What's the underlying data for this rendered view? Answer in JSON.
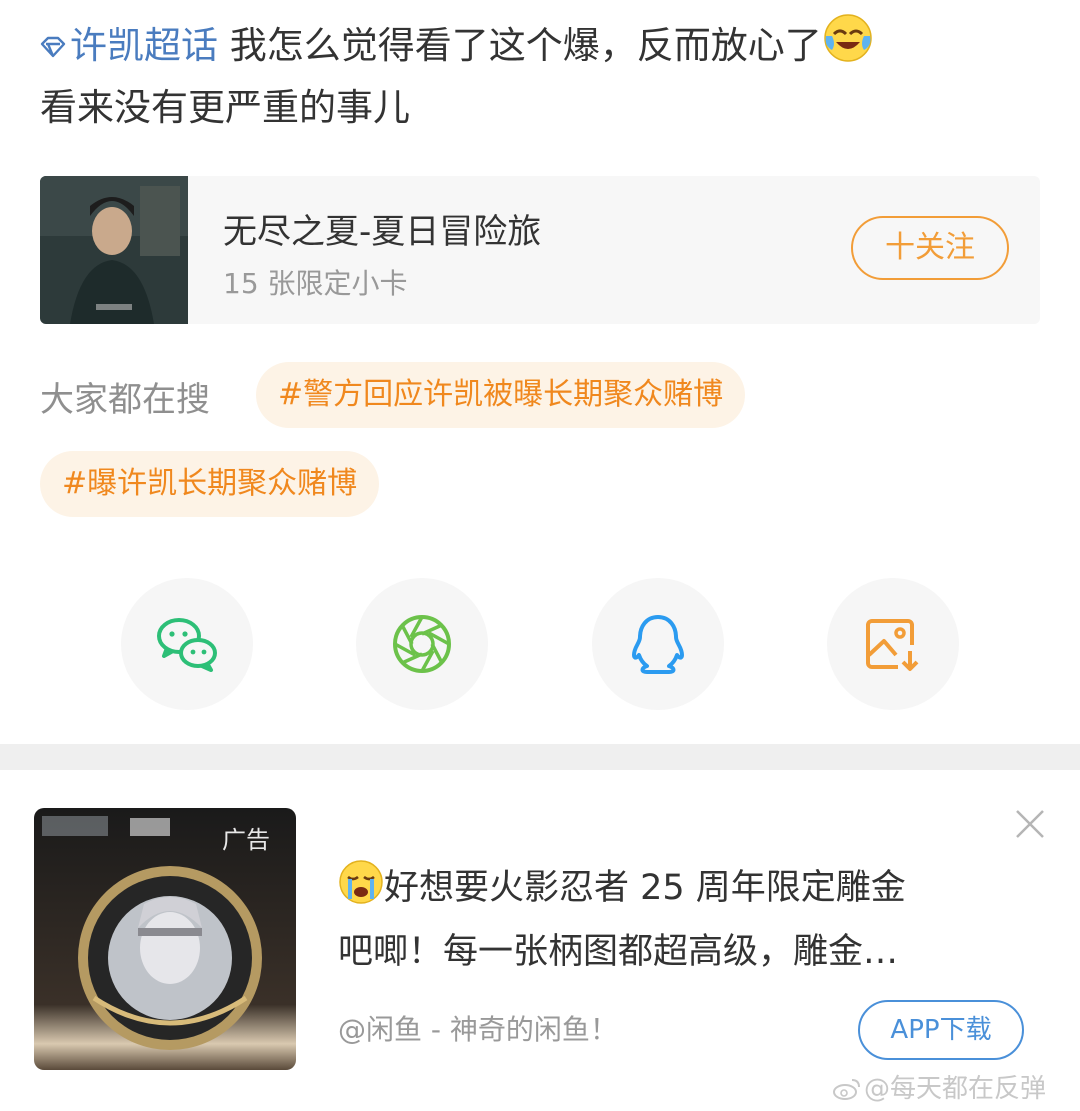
{
  "post": {
    "topic_link": "许凯超话",
    "text_line1": "我怎么觉得看了这个爆，反而放心了",
    "text_line2": "看来没有更严重的事儿"
  },
  "card": {
    "title": "无尽之夏-夏日冒险旅",
    "subtitle": "15 张限定小卡",
    "follow_label": "十关注"
  },
  "search": {
    "label": "大家都在搜",
    "tags": [
      "#警方回应许凯被曝长期聚众赌博",
      "#曝许凯长期聚众赌博"
    ]
  },
  "share": {
    "icons": [
      "wechat-icon",
      "moments-icon",
      "qq-icon",
      "save-image-icon"
    ]
  },
  "ad": {
    "badge": "广告",
    "text_line1": "好想要火影忍者 25 周年限定雕金",
    "text_line2": "吧唧！每一张柄图都超高级，雕金…",
    "source": "@闲鱼 - 神奇的闲鱼！",
    "download_label": "APP下载"
  },
  "watermark": "@每天都在反弹",
  "colors": {
    "topic_link": "#4a7cbf",
    "accent_orange": "#f29d38",
    "tag_text": "#f0881e",
    "tag_bg": "#fdf3e6",
    "app_button_blue": "#4a90d9",
    "wechat_green": "#2dbf77",
    "moments_green": "#6cc24a",
    "qq_blue": "#2b9bf0"
  }
}
